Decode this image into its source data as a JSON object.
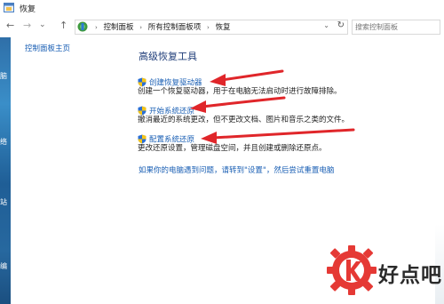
{
  "window": {
    "title": "恢复"
  },
  "nav": {
    "back_symbol": "←",
    "forward_symbol": "→",
    "recent_symbol": "⌄",
    "up_symbol": "↑"
  },
  "address": {
    "crumbs": [
      "控制面板",
      "所有控制面板项",
      "恢复"
    ],
    "separator": "›",
    "dropdown_symbol": "⌄",
    "refresh_symbol": "↻"
  },
  "search": {
    "placeholder": "搜索控制面板"
  },
  "sidebar": {
    "home_link": "控制面板主页"
  },
  "desktop": {
    "labels": [
      "脑",
      "络",
      "站",
      "编"
    ]
  },
  "main": {
    "heading": "高级恢复工具",
    "tasks": [
      {
        "link": "创建恢复驱动器",
        "description": "创建一个恢复驱动器，用于在电脑无法启动时进行故障排除。"
      },
      {
        "link": "开始系统还原",
        "description": "撤消最近的系统更改，但不更改文档、图片和音乐之类的文件。"
      },
      {
        "link": "配置系统还原",
        "description": "更改还原设置，管理磁盘空间，并且创建或删除还原点。"
      }
    ],
    "help_link": "如果你的电脑遇到问题，请转到\"设置\"，然后尝试重置电脑"
  },
  "watermark": {
    "text": "好点吧"
  },
  "colors": {
    "link": "#1a5fb4",
    "heading": "#1e3c78",
    "arrow": "#e0262a",
    "watermark_red": "#e53935",
    "shield_blue": "#2a6fd6",
    "shield_yellow": "#f5c518"
  },
  "icons": {
    "app": "recovery-window-icon",
    "address": "control-panel-icon",
    "task": "uac-shield-icon",
    "watermark": "gear-logo-icon"
  }
}
